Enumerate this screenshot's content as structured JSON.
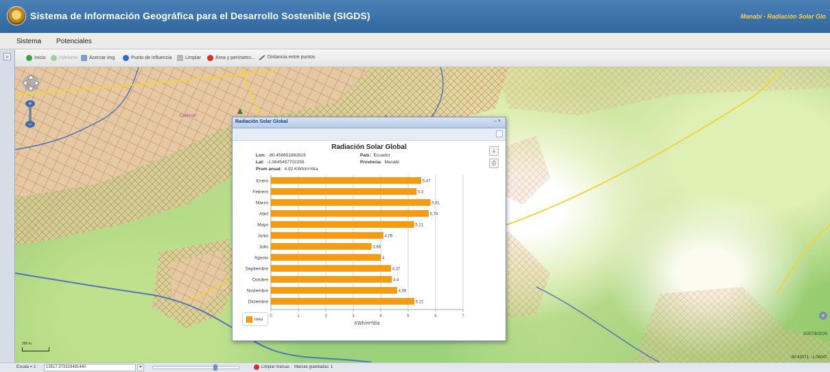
{
  "header": {
    "title": "Sistema de Información Geográfica para el Desarrollo Sostenible (SIGDS)",
    "breadcrumb": "Manabí - Radiación Solar Glo"
  },
  "menu": {
    "items": [
      "Sistema",
      "Potenciales"
    ]
  },
  "toolbar": {
    "items": [
      {
        "label": "Inicio",
        "icon": "green-circle-icon",
        "enabled": true
      },
      {
        "label": "Adelante",
        "icon": "green-circle-icon",
        "enabled": false
      },
      {
        "label": "Acercar img",
        "icon": "zoom-in-icon",
        "enabled": true
      },
      {
        "label": "Punto de influencia",
        "icon": "blue-point-icon",
        "enabled": true
      },
      {
        "label": "Limpiar",
        "icon": "eraser-icon",
        "enabled": true
      },
      {
        "label": "Área y perímetro...",
        "icon": "red-area-icon",
        "enabled": true
      },
      {
        "label": "Distancia entre puntos",
        "icon": "ruler-line-icon",
        "enabled": true
      }
    ]
  },
  "map": {
    "scale_label": "200 m",
    "date": "10/07/6/2020",
    "coords": "-80.43571, -1.06047",
    "place_label": "Calderon"
  },
  "popup": {
    "window_title": "Radiación Solar Global",
    "chart_title": "Radiación Solar Global",
    "info": {
      "lon_label": "Lon:",
      "lon_value": "-80.458651882823",
      "lat_label": "Lat:",
      "lat_value": "-1.0645457702258",
      "prom_label": "Prom anual:",
      "prom_value": "4.92 KWh/m²/día",
      "pais_label": "País:",
      "pais_value": "Ecuador",
      "provincia_label": "Provincia:",
      "provincia_value": "Manabí"
    },
    "legend_label": "mes"
  },
  "chart_data": {
    "type": "bar",
    "orientation": "horizontal",
    "title": "Radiación Solar Global",
    "xlabel": "KWh/m²/día",
    "categories": [
      "Enero",
      "Febrero",
      "Marzo",
      "Abril",
      "Mayo",
      "Junio",
      "Julio",
      "Agosto",
      "Septiembre",
      "Octubre",
      "Noviembre",
      "Diciembre"
    ],
    "series": [
      {
        "name": "mes",
        "values": [
          5.47,
          5.3,
          5.81,
          5.74,
          5.21,
          4.09,
          3.66,
          4,
          4.37,
          4.4,
          4.59,
          5.22
        ]
      }
    ],
    "xlim": [
      0,
      7
    ],
    "grid": true,
    "colors": {
      "bar": "#f39c12",
      "bar_stroke": "#d9860a"
    }
  },
  "statusbar": {
    "scale_label": "Escala = 1 :",
    "scale_value": "13517.373319481440",
    "clear_label": "Limpiar marcas",
    "saved_label": "Marcas guardadas: 1"
  }
}
